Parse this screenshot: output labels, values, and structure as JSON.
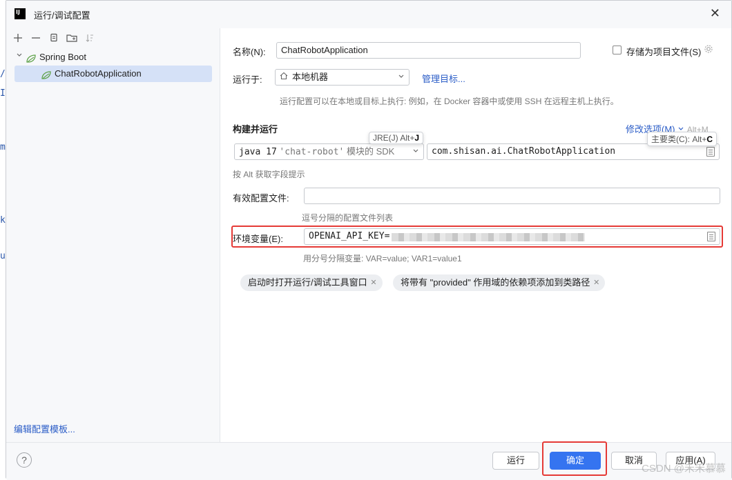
{
  "background": {
    "fragments": [
      "/",
      "I",
      "m",
      "k",
      "u"
    ]
  },
  "dialog": {
    "title": "运行/调试配置",
    "app_icon": "IJ",
    "close_icon": "✕"
  },
  "sidebar": {
    "tree": {
      "group_label": "Spring Boot",
      "item_label": "ChatRobotApplication"
    },
    "edit_templates": "编辑配置模板..."
  },
  "form": {
    "name_label": "名称(N):",
    "name_value": "ChatRobotApplication",
    "store_label": "存储为项目文件(S)",
    "run_on_label": "运行于:",
    "run_on_value": "本地机器",
    "manage_targets": "管理目标...",
    "run_on_hint": "运行配置可以在本地或目标上执行: 例如，在 Docker 容器中或使用 SSH 在远程主机上执行。",
    "build_run_title": "构建并运行",
    "modify_options": "修改选项(M)",
    "modify_shortcut": "Alt+M",
    "jre_tooltip_text": "JRE(J) Alt+",
    "jre_tooltip_key": "J",
    "main_class_tooltip_text": "主要类(C): Alt+",
    "main_class_tooltip_key": "C",
    "jdk_prefix": "java 17",
    "jdk_module": "'chat-robot'",
    "jdk_suffix": "模块的 SDK",
    "main_class": "com.shisan.ai.ChatRobotApplication",
    "alt_hint": "按 Alt 获取字段提示",
    "profiles_label": "有效配置文件:",
    "profiles_value": "",
    "profiles_hint": "逗号分隔的配置文件列表",
    "env_label": "环境变量(E):",
    "env_value": "OPENAI_API_KEY=",
    "env_hint": "用分号分隔变量: VAR=value; VAR1=value1",
    "chips": [
      "启动时打开运行/调试工具窗口",
      "将带有 \"provided\" 作用域的依赖项添加到类路径"
    ]
  },
  "footer": {
    "help": "?",
    "run": "运行",
    "ok": "确定",
    "cancel": "取消",
    "apply": "应用(A)"
  },
  "watermark": "CSDN @禾禾慕慕",
  "colors": {
    "accent": "#3574f0",
    "highlight": "#e53935",
    "link": "#2a5cc7"
  }
}
